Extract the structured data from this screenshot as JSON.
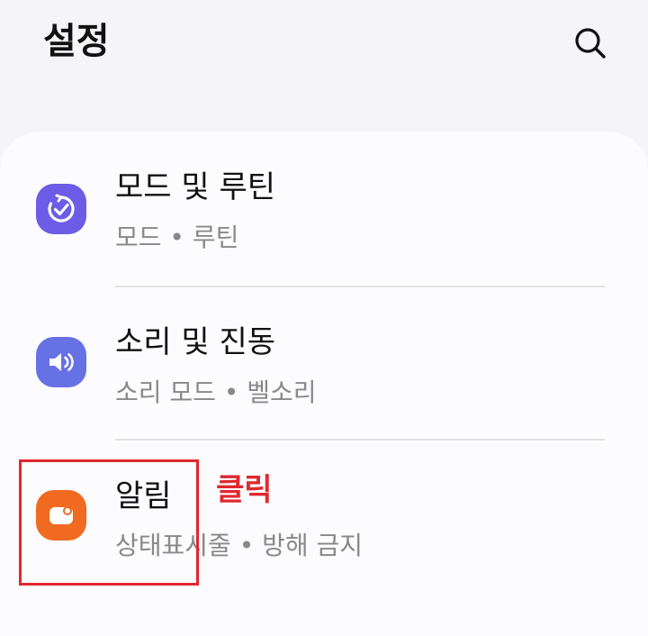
{
  "header": {
    "title": "설정",
    "search_icon": "search-icon"
  },
  "settings": {
    "items": [
      {
        "title": "모드 및 루틴",
        "subtitle": "모드 • 루틴",
        "icon": "modes-routines-icon",
        "icon_color": "#6d5ce6"
      },
      {
        "title": "소리 및 진동",
        "subtitle": "소리 모드 • 벨소리",
        "icon": "speaker-icon",
        "icon_color": "#6671e6"
      },
      {
        "title": "알림",
        "subtitle": "상태표시줄 • 방해 금지",
        "icon": "notification-icon",
        "icon_color": "#f06a1f"
      }
    ]
  },
  "annotation": {
    "label": "클릭",
    "color": "#e0282e"
  }
}
